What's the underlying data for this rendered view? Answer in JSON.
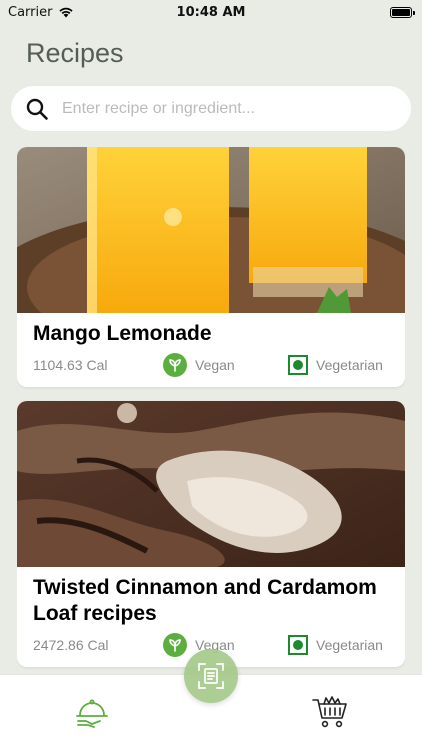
{
  "status_bar": {
    "carrier": "Carrier",
    "time": "10:48 AM"
  },
  "page": {
    "title": "Recipes"
  },
  "search": {
    "placeholder": "Enter recipe or ingredient..."
  },
  "recipes": [
    {
      "title": "Mango Lemonade",
      "calories": "1104.63 Cal",
      "tags": [
        {
          "label": "Vegan",
          "icon": "vegan-leaf-icon"
        },
        {
          "label": "Vegetarian",
          "icon": "vegetarian-symbol-icon"
        }
      ]
    },
    {
      "title": "Twisted Cinnamon and Cardamom Loaf recipes",
      "calories": "2472.86 Cal",
      "tags": [
        {
          "label": "Vegan",
          "icon": "vegan-leaf-icon"
        },
        {
          "label": "Vegetarian",
          "icon": "vegetarian-symbol-icon"
        }
      ]
    }
  ],
  "tab_bar": {
    "items": [
      {
        "icon": "serving-tray-icon"
      },
      {
        "icon": "document-scan-icon"
      },
      {
        "icon": "shopping-cart-icon"
      }
    ]
  },
  "colors": {
    "background": "#e8ece4",
    "accent_green": "#5cae3f",
    "veg_green": "#1b8a2d",
    "scan_button": "#a6c98a"
  }
}
